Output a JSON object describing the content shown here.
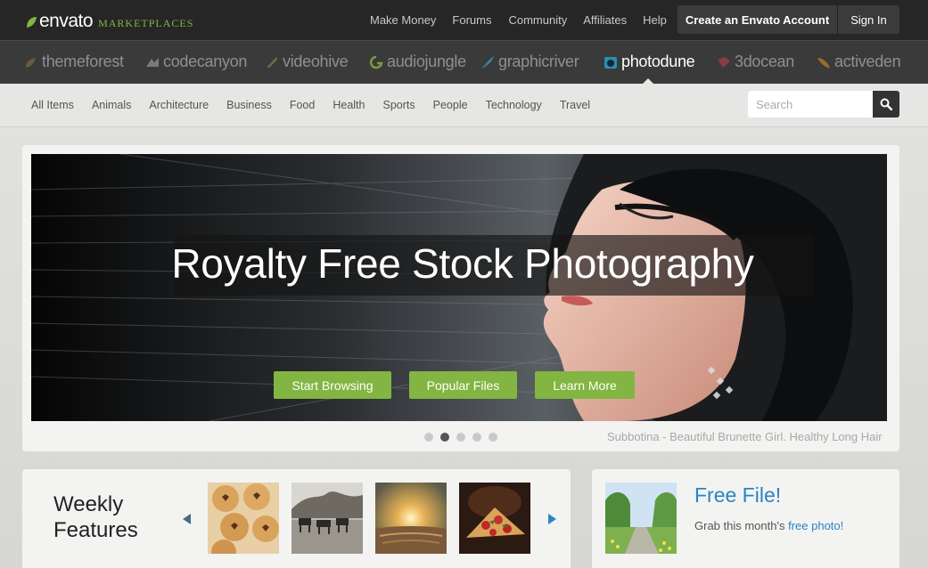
{
  "brand": {
    "name": "envato",
    "sub": "MARKETPLACES",
    "accent": "#82b541"
  },
  "top_nav": [
    "Make Money",
    "Forums",
    "Community",
    "Affiliates",
    "Help"
  ],
  "account": {
    "create_label": "Create an Envato Account",
    "signin_label": "Sign In"
  },
  "marketplaces": [
    {
      "label": "themeforest",
      "icon": "themeforest-icon"
    },
    {
      "label": "codecanyon",
      "icon": "codecanyon-icon"
    },
    {
      "label": "videohive",
      "icon": "videohive-icon"
    },
    {
      "label": "audiojungle",
      "icon": "audiojungle-icon"
    },
    {
      "label": "graphicriver",
      "icon": "graphicriver-icon"
    },
    {
      "label": "photodune",
      "icon": "photodune-icon",
      "active": true
    },
    {
      "label": "3docean",
      "icon": "3docean-icon"
    },
    {
      "label": "activeden",
      "icon": "activeden-icon"
    }
  ],
  "categories": [
    "All Items",
    "Animals",
    "Architecture",
    "Business",
    "Food",
    "Health",
    "Sports",
    "People",
    "Technology",
    "Travel"
  ],
  "search": {
    "placeholder": "Search"
  },
  "hero": {
    "title": "Royalty Free Stock Photography",
    "buttons": [
      "Start Browsing",
      "Popular Files",
      "Learn More"
    ],
    "caption": "Subbotina - Beautiful Brunette Girl. Healthy Long Hair",
    "slides": 5,
    "active_slide": 2
  },
  "weekly": {
    "title_line1": "Weekly",
    "title_line2": "Features"
  },
  "free_file": {
    "title": "Free File!",
    "text_prefix": "Grab this month's ",
    "link": "free photo!"
  },
  "colors": {
    "link": "#2a84c1",
    "button_green": "#82b541",
    "topbar": "#262626",
    "marketbar": "#3a3a3a"
  }
}
